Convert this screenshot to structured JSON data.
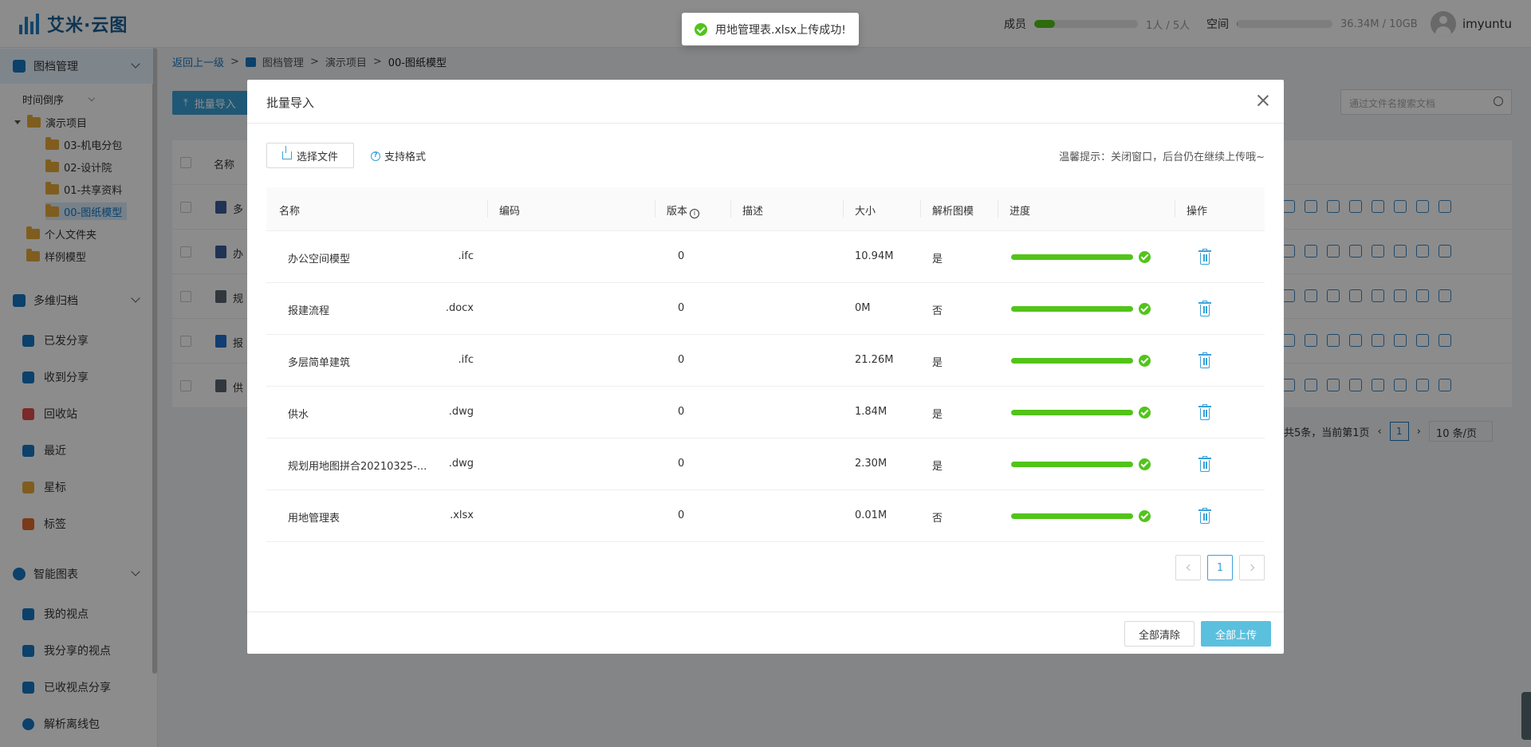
{
  "app": {
    "name": "艾米·云图"
  },
  "header": {
    "members_label": "成员",
    "members_count": "1人 / 5人",
    "members_fraction": 0.2,
    "space_label": "空间",
    "space_count": "36.34M / 10GB",
    "space_fraction": 0.0035,
    "username": "imyuntu"
  },
  "toast": {
    "message": "用地管理表.xlsx上传成功!"
  },
  "sidebar": {
    "doc_section": "图档管理",
    "sort_label": "时间倒序",
    "tree": {
      "project": "演示项目",
      "folders": [
        "03-机电分包",
        "02-设计院",
        "01-共享资料",
        "00-图纸模型"
      ],
      "personal": "个人文件夹",
      "samples": "样例模型"
    },
    "archive_section": "多维归档",
    "archive_items": [
      "已发分享",
      "收到分享",
      "回收站",
      "最近",
      "星标",
      "标签"
    ],
    "report_section": "智能图表",
    "report_items": [
      "我的视点",
      "我分享的视点",
      "已收视点分享",
      "解析离线包"
    ]
  },
  "breadcrumb": {
    "back": "返回上一级",
    "sep": ">",
    "items": [
      "图档管理",
      "演示项目",
      "00-图纸模型"
    ]
  },
  "toolbar": {
    "batch_import": "批量导入",
    "search_placeholder": "通过文件名搜索文档"
  },
  "bg_table": {
    "name_header": "名称",
    "rows": [
      "多",
      "办",
      "规",
      "报",
      "供"
    ]
  },
  "bg_pager": {
    "summary": "共5条，当前第1页",
    "page": "1",
    "page_size": "10 条/页"
  },
  "modal": {
    "title": "批量导入",
    "select_file": "选择文件",
    "support_format": "支持格式",
    "tip": "温馨提示：关闭窗口，后台仍在继续上传哦~",
    "columns": {
      "name": "名称",
      "code": "编码",
      "version": "版本",
      "desc": "描述",
      "size": "大小",
      "parse": "解析图模",
      "progress": "进度",
      "action": "操作"
    },
    "files": [
      {
        "name": "办公空间模型",
        "ext": ".ifc",
        "version": "0",
        "size": "10.94M",
        "parse": "是",
        "progress": 1.0
      },
      {
        "name": "报建流程",
        "ext": ".docx",
        "version": "0",
        "size": "0M",
        "parse": "否",
        "progress": 1.0
      },
      {
        "name": "多层简单建筑",
        "ext": ".ifc",
        "version": "0",
        "size": "21.26M",
        "parse": "是",
        "progress": 1.0
      },
      {
        "name": "供水",
        "ext": ".dwg",
        "version": "0",
        "size": "1.84M",
        "parse": "是",
        "progress": 1.0
      },
      {
        "name": "规划用地图拼合20210325-...",
        "ext": ".dwg",
        "version": "0",
        "size": "2.30M",
        "parse": "是",
        "progress": 1.0
      },
      {
        "name": "用地管理表",
        "ext": ".xlsx",
        "version": "0",
        "size": "0.01M",
        "parse": "否",
        "progress": 1.0
      }
    ],
    "pager": {
      "page": "1"
    },
    "clear_all": "全部清除",
    "upload_all": "全部上传"
  },
  "colors": {
    "accent": "#3aa0d8",
    "success": "#52c41a",
    "brand": "#1b5f94"
  }
}
